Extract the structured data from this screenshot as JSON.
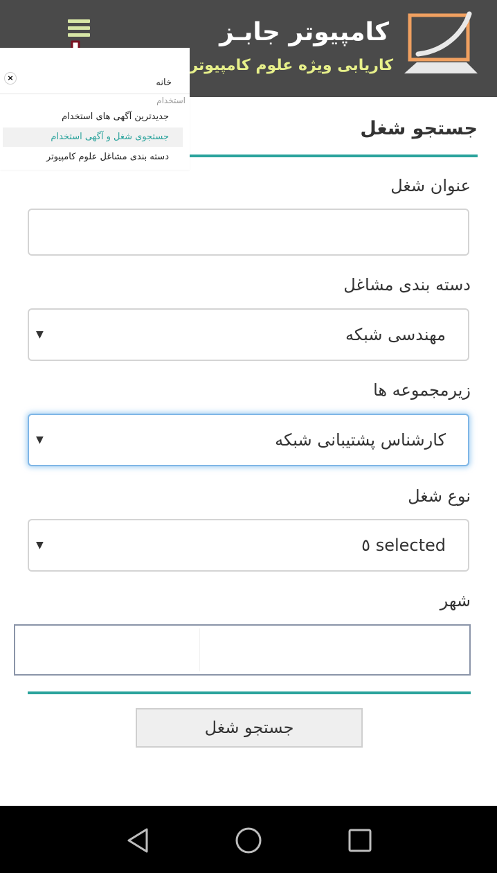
{
  "header": {
    "logo_title": "کامپیوتر جابـز",
    "logo_subtitle": "کاریابی ویژه علوم کامپیوتری",
    "menu_icon": "hamburger-icon",
    "indicator_icon": "down-arrow-icon",
    "colors": {
      "background": "#4a4a4a",
      "subtitle": "#e7f08a",
      "logo_accent": "#f0a060"
    }
  },
  "menu": {
    "close_icon": "close-icon",
    "close_glyph": "×",
    "home": "خانه",
    "group_label": "استخدام",
    "items": [
      {
        "label": "جدیدترین آگهی های استخدام",
        "active": false
      },
      {
        "label": "جستجوی شغل و آگهی استخدام",
        "active": true
      },
      {
        "label": "دسته بندی مشاغل علوم کامپیوتر",
        "active": false
      }
    ]
  },
  "form": {
    "page_title": "جستجو شغل",
    "job_title": {
      "label": "عنوان شغل",
      "value": ""
    },
    "category": {
      "label": "دسته بندی مشاغل",
      "selected": "مهندسی شبکه"
    },
    "subcategory": {
      "label": "زیرمجموعه ها",
      "selected": "کارشناس پشتیبانی شبکه"
    },
    "job_type": {
      "label": "نوع شغل",
      "selected": "selected ٥"
    },
    "city": {
      "label": "شهر",
      "value": ""
    },
    "submit_label": "جستجو شغل",
    "caret_glyph": "▼",
    "accent_color": "#2aa39c"
  },
  "navbar": {
    "back_icon": "back-triangle-icon",
    "home_icon": "home-circle-icon",
    "recents_icon": "recents-square-icon"
  }
}
